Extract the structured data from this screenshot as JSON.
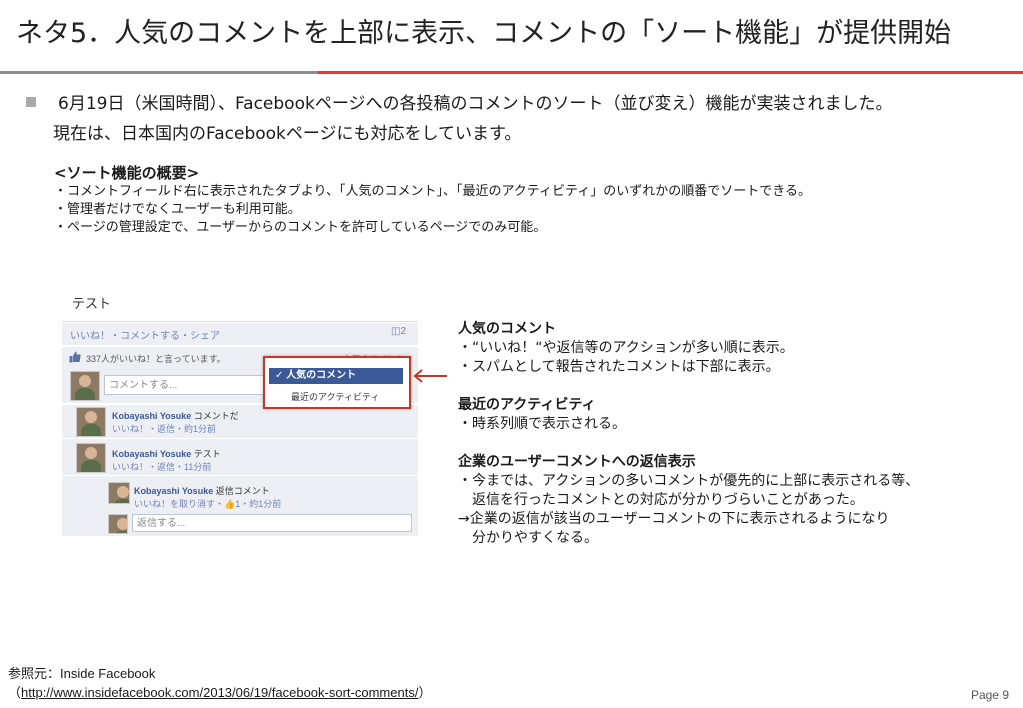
{
  "title": "ネタ5．人気のコメントを上部に表示、コメントの「ソート機能」が提供開始",
  "lead": {
    "line1": "6月19日（米国時間）、Facebookページへの各投稿のコメントのソート（並び変え）機能が実装されました。",
    "line2": "現在は、日本国内のFacebookページにも対応をしています。"
  },
  "overview": {
    "heading": "<ソート機能の概要>",
    "items": [
      "・コメントフィールド右に表示されたタブより、「人気のコメント」、「最近のアクティビティ」のいずれかの順番でソートできる。",
      "・管理者だけでなくユーザーも利用可能。",
      "・ページの管理設定で、ユーザーからのコメントを許可しているページでのみ可能。"
    ]
  },
  "fb_mock": {
    "post_title": "テスト",
    "actions": "いいね！・コメントする・シェア",
    "share_count": "2",
    "likes": "337人がいいね！と言っています。",
    "sort_tab": "人気のコメント▾",
    "compose_placeholder": "コメントする...",
    "comments": [
      {
        "name": "Kobayashi Yosuke",
        "text": "コメントだ",
        "meta": "いいね！・返信・約1分前"
      },
      {
        "name": "Kobayashi Yosuke",
        "text": "テスト",
        "meta": "いいね！・返信・11分前"
      }
    ],
    "reply": {
      "name": "Kobayashi Yosuke",
      "text": "返信コメント",
      "meta": "いいね！を取り消す・👍1・約1分前"
    },
    "reply_placeholder": "返信する...",
    "dropdown": {
      "selected": "✓ 人気のコメント",
      "other": "最近のアクティビティ"
    }
  },
  "notes": {
    "popular_heading": "人気のコメント",
    "popular_lines": [
      "・“いいね！“や返信等のアクションが多い順に表示。",
      "・スパムとして報告されたコメントは下部に表示。"
    ],
    "recent_heading": "最近のアクティビティ",
    "recent_lines": [
      "・時系列順で表示される。"
    ],
    "corp_heading": "企業のユーザーコメントへの返信表示",
    "corp_lines": [
      "・今までは、アクションの多いコメントが優先的に上部に表示される等、",
      "　返信を行ったコメントとの対応が分かりづらいことがあった。",
      "→企業の返信が該当のユーザーコメントの下に表示されるようになり",
      "　分かりやすくなる。"
    ]
  },
  "reference": {
    "label": "参照元：Inside Facebook",
    "open": "（",
    "url": "http://www.insidefacebook.com/2013/06/19/facebook-sort-comments/",
    "close": "）"
  },
  "page_number": "Page 9",
  "colors": {
    "accent_red": "#e03a3a",
    "rule_gray": "#8c8c8c",
    "fb_blue": "#3b5998"
  }
}
